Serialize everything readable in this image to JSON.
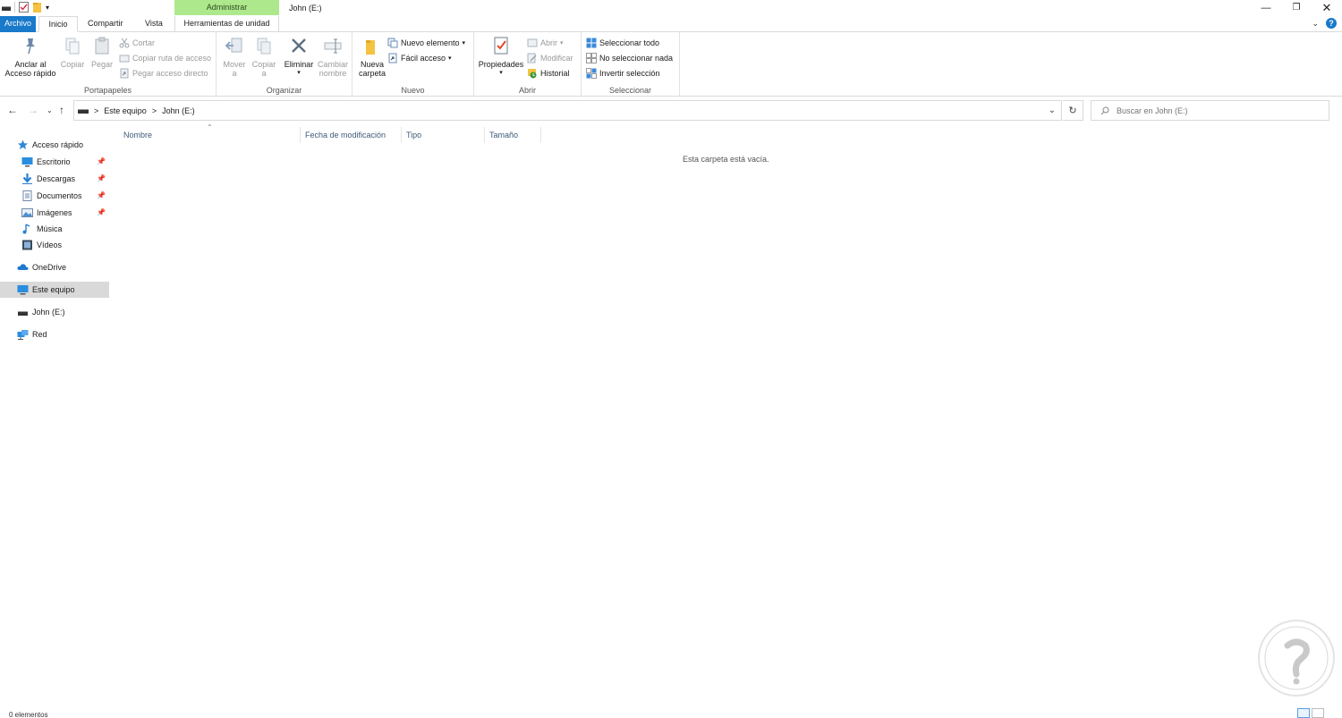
{
  "window": {
    "title": "John (E:)",
    "context_group": "Administrar"
  },
  "tabs": {
    "archivo": "Archivo",
    "inicio": "Inicio",
    "compartir": "Compartir",
    "vista": "Vista",
    "herramientas": "Herramientas de unidad"
  },
  "ribbon": {
    "portapapeles": {
      "label": "Portapapeles",
      "pin_line1": "Anclar al",
      "pin_line2": "Acceso rápido",
      "copy": "Copiar",
      "paste": "Pegar",
      "cut": "Cortar",
      "copy_path": "Copiar ruta de acceso",
      "paste_shortcut": "Pegar acceso directo"
    },
    "organizar": {
      "label": "Organizar",
      "move_line1": "Mover",
      "move_line2": "a",
      "copyto_line1": "Copiar",
      "copyto_line2": "a",
      "delete": "Eliminar",
      "rename_line1": "Cambiar",
      "rename_line2": "nombre"
    },
    "nuevo": {
      "label": "Nuevo",
      "newfolder_line1": "Nueva",
      "newfolder_line2": "carpeta",
      "new_item": "Nuevo elemento",
      "easy_access": "Fácil acceso"
    },
    "abrir": {
      "label": "Abrir",
      "properties": "Propiedades",
      "open": "Abrir",
      "edit": "Modificar",
      "history": "Historial"
    },
    "seleccionar": {
      "label": "Seleccionar",
      "select_all": "Seleccionar todo",
      "select_none": "No seleccionar nada",
      "invert": "Invertir selección"
    }
  },
  "address": {
    "crumb1": "Este equipo",
    "crumb2": "John (E:)",
    "separator": ">"
  },
  "search": {
    "placeholder": "Buscar en John (E:)"
  },
  "nav": {
    "quick_access": "Acceso rápido",
    "desktop": "Escritorio",
    "downloads": "Descargas",
    "documents": "Documentos",
    "pictures": "Imágenes",
    "music": "Música",
    "videos": "Vídeos",
    "onedrive": "OneDrive",
    "this_pc": "Este equipo",
    "drive": "John (E:)",
    "network": "Red"
  },
  "columns": {
    "name": "Nombre",
    "modified": "Fecha de modificación",
    "type": "Tipo",
    "size": "Tamaño"
  },
  "content": {
    "empty_message": "Esta carpeta está vacía."
  },
  "status": {
    "items": "0 elementos"
  },
  "colors": {
    "accent": "#1979ca",
    "context_tab": "#aee88c",
    "selected_nav": "#d9d9d9"
  }
}
